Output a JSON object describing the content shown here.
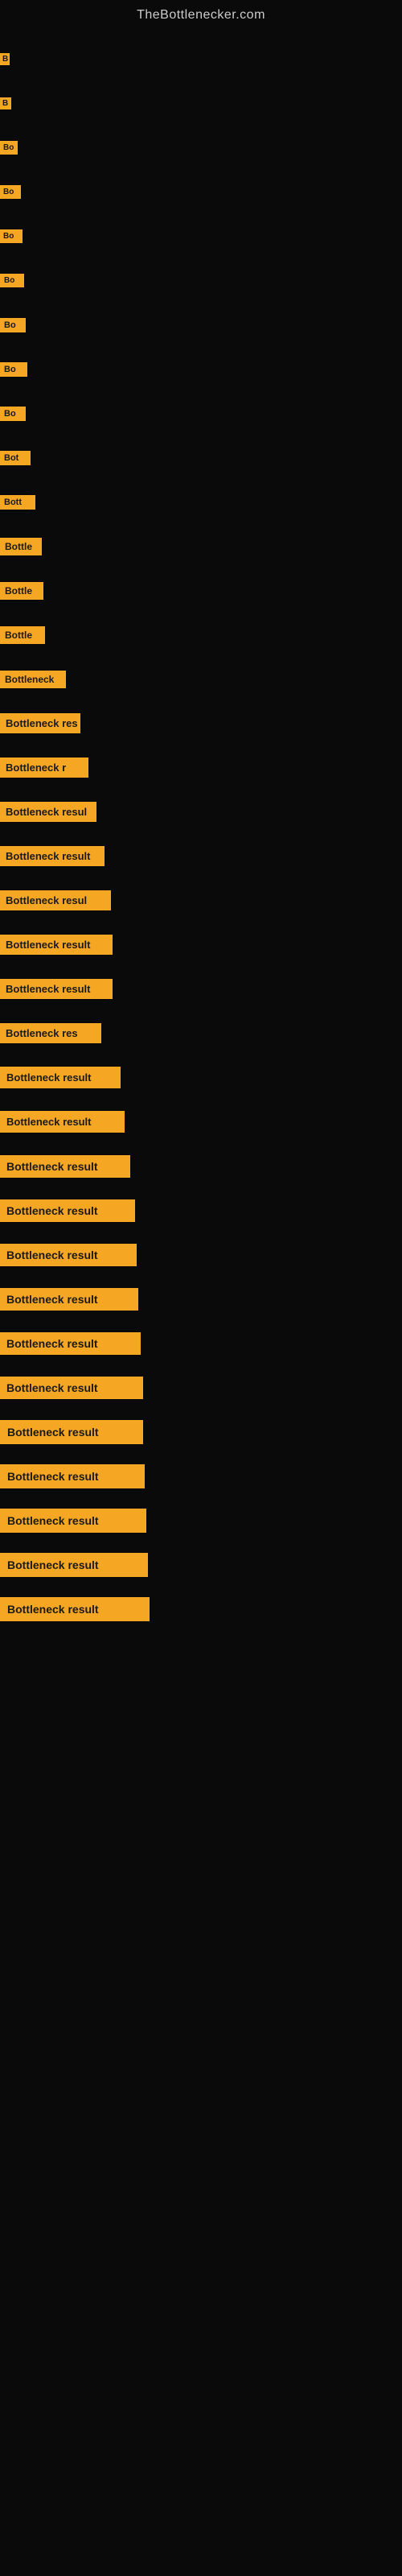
{
  "site": {
    "title": "TheBottlenecker.com"
  },
  "items": [
    {
      "id": 1,
      "label": "B",
      "class": "item-1"
    },
    {
      "id": 2,
      "label": "B",
      "class": "item-2"
    },
    {
      "id": 3,
      "label": "Bo",
      "class": "item-3"
    },
    {
      "id": 4,
      "label": "Bo",
      "class": "item-4"
    },
    {
      "id": 5,
      "label": "Bo",
      "class": "item-5"
    },
    {
      "id": 6,
      "label": "Bo",
      "class": "item-6"
    },
    {
      "id": 7,
      "label": "Bo",
      "class": "item-7"
    },
    {
      "id": 8,
      "label": "Bo",
      "class": "item-8"
    },
    {
      "id": 9,
      "label": "Bo",
      "class": "item-9"
    },
    {
      "id": 10,
      "label": "Bot",
      "class": "item-10"
    },
    {
      "id": 11,
      "label": "Bott",
      "class": "item-11"
    },
    {
      "id": 12,
      "label": "Bottle",
      "class": "item-12"
    },
    {
      "id": 13,
      "label": "Bottle",
      "class": "item-13"
    },
    {
      "id": 14,
      "label": "Bottle",
      "class": "item-14"
    },
    {
      "id": 15,
      "label": "Bottleneck",
      "class": "item-15"
    },
    {
      "id": 16,
      "label": "Bottleneck res",
      "class": "item-16"
    },
    {
      "id": 17,
      "label": "Bottleneck r",
      "class": "item-17"
    },
    {
      "id": 18,
      "label": "Bottleneck resul",
      "class": "item-18"
    },
    {
      "id": 19,
      "label": "Bottleneck result",
      "class": "item-19"
    },
    {
      "id": 20,
      "label": "Bottleneck resul",
      "class": "item-20"
    },
    {
      "id": 21,
      "label": "Bottleneck result",
      "class": "item-21"
    },
    {
      "id": 22,
      "label": "Bottleneck result",
      "class": "item-22"
    },
    {
      "id": 23,
      "label": "Bottleneck res",
      "class": "item-23"
    },
    {
      "id": 24,
      "label": "Bottleneck result",
      "class": "item-24"
    },
    {
      "id": 25,
      "label": "Bottleneck result",
      "class": "item-25"
    },
    {
      "id": 26,
      "label": "Bottleneck result",
      "class": "item-26"
    },
    {
      "id": 27,
      "label": "Bottleneck result",
      "class": "item-27"
    },
    {
      "id": 28,
      "label": "Bottleneck result",
      "class": "item-28"
    },
    {
      "id": 29,
      "label": "Bottleneck result",
      "class": "item-29"
    },
    {
      "id": 30,
      "label": "Bottleneck result",
      "class": "item-30"
    },
    {
      "id": 31,
      "label": "Bottleneck result",
      "class": "item-31"
    },
    {
      "id": 32,
      "label": "Bottleneck result",
      "class": "item-32"
    },
    {
      "id": 33,
      "label": "Bottleneck result",
      "class": "item-33"
    },
    {
      "id": 34,
      "label": "Bottleneck result",
      "class": "item-34"
    },
    {
      "id": 35,
      "label": "Bottleneck result",
      "class": "item-35"
    },
    {
      "id": 36,
      "label": "Bottleneck result",
      "class": "item-36"
    }
  ]
}
